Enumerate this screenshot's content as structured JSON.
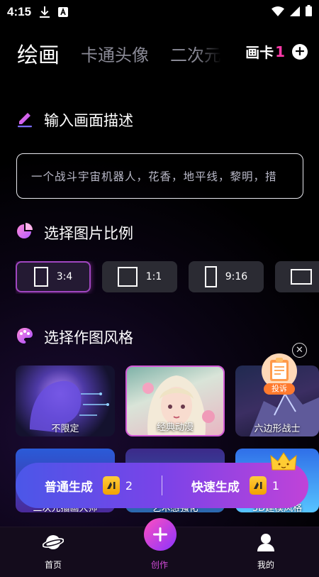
{
  "status_bar": {
    "time": "4:15"
  },
  "tabs": [
    {
      "label": "绘画",
      "active": true
    },
    {
      "label": "卡通头像",
      "active": false
    },
    {
      "label": "二次元",
      "active": false
    }
  ],
  "card_count": {
    "label": "画卡",
    "count": "1"
  },
  "sections": {
    "prompt_title": "输入画面描述",
    "ratio_title": "选择图片比例",
    "style_title": "选择作图风格"
  },
  "prompt": {
    "text": "一个战斗宇宙机器人，花香，地平线，黎明，措"
  },
  "ratios": [
    {
      "label": "3:4",
      "selected": true
    },
    {
      "label": "1:1",
      "selected": false
    },
    {
      "label": "9:16",
      "selected": false
    },
    {
      "label": "",
      "selected": false
    }
  ],
  "styles": [
    {
      "label": "不限定",
      "selected": false
    },
    {
      "label": "经典动漫",
      "selected": true
    },
    {
      "label": "六边形战士",
      "selected": false
    }
  ],
  "styles_row2": [
    {
      "label": "二次元插画大师"
    },
    {
      "label": "艺术感强化"
    },
    {
      "label": "3D建模风格"
    }
  ],
  "generate": {
    "normal_label": "普通生成",
    "normal_cost": "2",
    "fast_label": "快速生成",
    "fast_cost": "1"
  },
  "float_report": {
    "label": "投诉"
  },
  "nav": [
    {
      "label": "首页",
      "icon": "planet-icon"
    },
    {
      "label": "创作",
      "icon": "plus-icon",
      "active": true
    },
    {
      "label": "我的",
      "icon": "user-icon"
    }
  ],
  "colors": {
    "accent": "#d14bd8",
    "pink": "#ff3aa9",
    "gen_start": "#4b57e8",
    "gen_end": "#c043d8"
  }
}
